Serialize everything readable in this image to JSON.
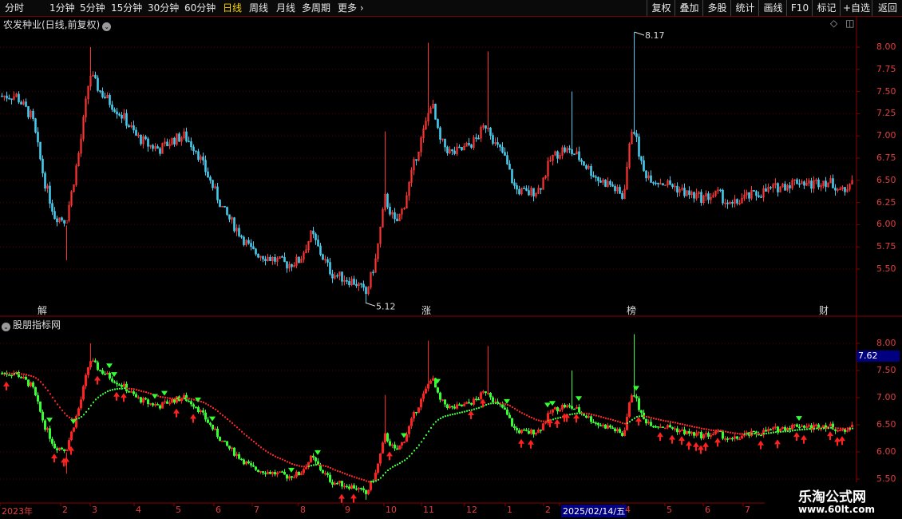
{
  "toolbar": {
    "periods": [
      "分时",
      "1分钟",
      "5分钟",
      "15分钟",
      "30分钟",
      "60分钟",
      "日线",
      "周线",
      "月线",
      "多周期",
      "更多"
    ],
    "active_period": "日线",
    "more_icon": "chevron-right-icon",
    "right_buttons": [
      "复权",
      "叠加",
      "多股",
      "统计",
      "画线",
      "F10",
      "标记",
      "+自选",
      "返回"
    ]
  },
  "main_panel": {
    "title": "农发种业(日线,前复权)",
    "high_label": "8.17",
    "low_label": "5.12",
    "y_ticks": [
      "8.00",
      "7.75",
      "7.50",
      "7.25",
      "7.00",
      "6.75",
      "6.50",
      "6.25",
      "6.00",
      "5.75",
      "5.50"
    ],
    "event_markers": [
      {
        "text": "解",
        "color": "#3ab0ff"
      },
      {
        "text": "涨",
        "color": "#ff4040"
      },
      {
        "text": "榜",
        "color": "#ffaa00"
      },
      {
        "text": "财",
        "color": "#3ab0ff"
      }
    ]
  },
  "indicator_panel": {
    "title": "股朋指标网",
    "y_ticks": [
      "8.00",
      "7.50",
      "7.00",
      "6.50",
      "6.00",
      "5.50"
    ],
    "current_value": "7.62"
  },
  "x_axis": {
    "labels": [
      "2023年",
      "2",
      "3",
      "4",
      "5",
      "6",
      "7",
      "8",
      "9",
      "10",
      "11",
      "12",
      "1",
      "2",
      "2025/02/14/五",
      "4",
      "5",
      "6",
      "7"
    ]
  },
  "watermark": {
    "line1": "乐淘公式网",
    "line2": "www.60lt.com"
  },
  "colors": {
    "up": "#ff3333",
    "down": "#44ccee",
    "bull": "#33ff33",
    "bear": "#ff2222",
    "accent": "#ffd700"
  }
}
